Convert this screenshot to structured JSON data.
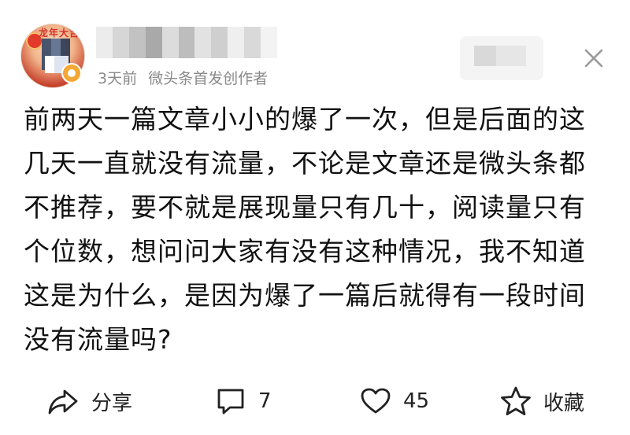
{
  "post": {
    "meta": {
      "time": "3天前",
      "source": "微头条首发创作者"
    },
    "body": "前两天一篇文章小小的爆了一次，但是后面的这几天一直就没有流量，不论是文章还是微头条都不推荐，要不就是展现量只有几十，阅读量只有个位数，想问问大家有没有这种情况，我不知道这是为什么，是因为爆了一篇后就得有一段时间没有流量吗?"
  },
  "header": {
    "avatar_text": "龙年大吉",
    "close_icon": "close-icon"
  },
  "actions": {
    "share": {
      "icon": "share-icon",
      "label": "分享"
    },
    "comment": {
      "icon": "comment-icon",
      "count": "7"
    },
    "like": {
      "icon": "heart-icon",
      "count": "45"
    },
    "favorite": {
      "icon": "star-icon",
      "label": "收藏"
    }
  },
  "colors": {
    "meta_text": "#8a8a8a",
    "body_text": "#111111",
    "icon_stroke": "#222222"
  }
}
